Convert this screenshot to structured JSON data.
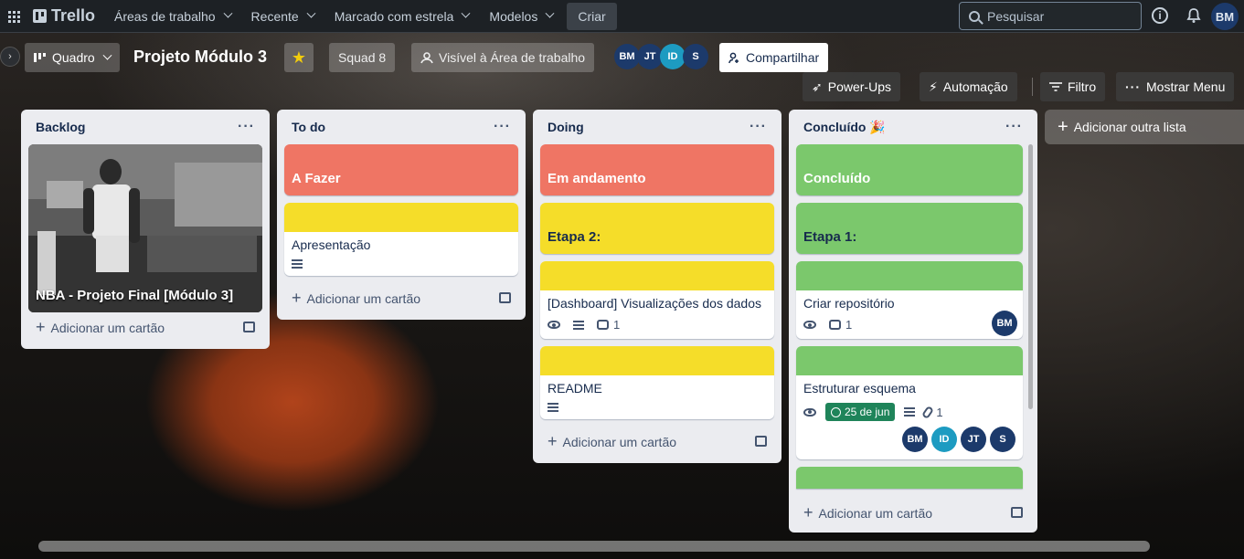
{
  "nav": {
    "logo": "Trello",
    "workspaces": "Áreas de trabalho",
    "recent": "Recente",
    "starred": "Marcado com estrela",
    "templates": "Modelos",
    "create": "Criar",
    "search_placeholder": "Pesquisar",
    "info": "i",
    "user_initials": "BM"
  },
  "board": {
    "view": "Quadro",
    "title": "Projeto Módulo 3",
    "workspace": "Squad 8",
    "visibility": "Visível à Área de trabalho",
    "members": [
      {
        "initials": "BM",
        "color": "#1c3a6b"
      },
      {
        "initials": "JT",
        "color": "#1c3a6b"
      },
      {
        "initials": "ID",
        "color": "#1d9bc1"
      },
      {
        "initials": "S",
        "color": "#1c3a6b"
      }
    ],
    "share": "Compartilhar",
    "power_ups": "Power-Ups",
    "automation": "Automação",
    "filter": "Filtro",
    "show_menu": "Mostrar Menu",
    "add_list": "Adicionar outra lista",
    "add_card": "Adicionar um cartão"
  },
  "lists": {
    "backlog": {
      "title": "Backlog",
      "card": "NBA - Projeto Final [Módulo 3]"
    },
    "todo": {
      "title": "To do",
      "label_card": "A Fazer",
      "card": "Apresentação"
    },
    "doing": {
      "title": "Doing",
      "label_card": "Em andamento",
      "stage": "Etapa 2:",
      "card1": "[Dashboard] Visualizações dos dados",
      "card1_comments": "1",
      "card2": "README"
    },
    "done": {
      "title": "Concluído",
      "emoji": "🎉",
      "label_card": "Concluído",
      "stage": "Etapa 1:",
      "card1": "Criar repositório",
      "card1_comments": "1",
      "card1_member": "BM",
      "card2": "Estruturar esquema",
      "card2_due": "25 de jun",
      "card2_attachments": "1",
      "card2_members": [
        "BM",
        "ID",
        "JT",
        "S"
      ]
    }
  },
  "colors": {
    "red": "#ef7564",
    "yellow": "#f5dd29",
    "green": "#7bc86c"
  }
}
